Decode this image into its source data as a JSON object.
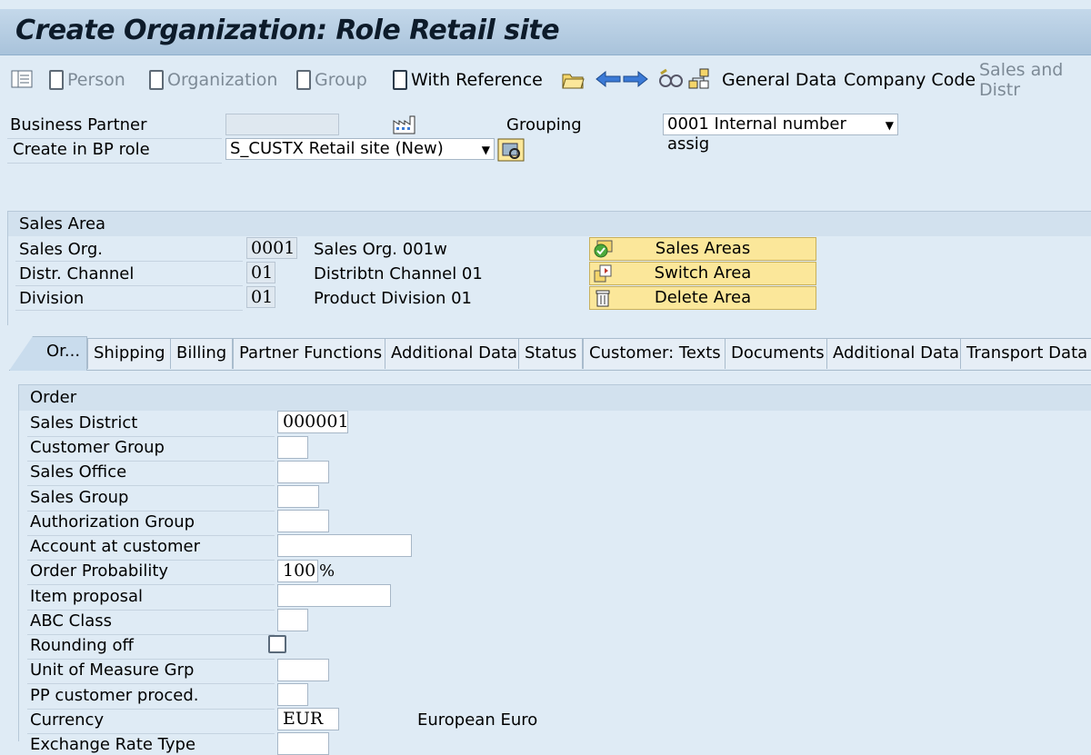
{
  "window": {
    "title": "Create Organization: Role Retail site"
  },
  "toolbar": {
    "person": "Person",
    "organization": "Organization",
    "group": "Group",
    "with_reference": "With Reference",
    "general_data": "General Data",
    "company_code": "Company Code",
    "sales_and_distr": "Sales and Distr"
  },
  "header": {
    "business_partner_label": "Business Partner",
    "business_partner_value": "",
    "grouping_label": "Grouping",
    "grouping_value": "0001 Internal number assig",
    "create_in_role_label": "Create in BP role",
    "create_in_role_value": "S_CUSTX Retail site (New)"
  },
  "sales_area": {
    "title": "Sales Area",
    "sales_org_label": "Sales Org.",
    "sales_org_value": "0001",
    "sales_org_desc": "Sales Org. 001w",
    "distr_channel_label": "Distr. Channel",
    "distr_channel_value": "01",
    "distr_channel_desc": "Distribtn Channel 01",
    "division_label": "Division",
    "division_value": "01",
    "division_desc": "Product Division 01",
    "btn_sales_areas": "Sales Areas",
    "btn_switch_area": "Switch Area",
    "btn_delete_area": "Delete Area"
  },
  "tabs": [
    {
      "label": "Or..."
    },
    {
      "label": "Shipping"
    },
    {
      "label": "Billing"
    },
    {
      "label": "Partner Functions"
    },
    {
      "label": "Additional Data"
    },
    {
      "label": "Status"
    },
    {
      "label": "Customer: Texts"
    },
    {
      "label": "Documents"
    },
    {
      "label": "Additional Data"
    },
    {
      "label": "Transport Data"
    }
  ],
  "order": {
    "title": "Order",
    "fields": [
      {
        "label": "Sales District",
        "value": "000001"
      },
      {
        "label": "Customer Group",
        "value": ""
      },
      {
        "label": "Sales Office",
        "value": ""
      },
      {
        "label": "Sales Group",
        "value": ""
      },
      {
        "label": "Authorization Group",
        "value": ""
      },
      {
        "label": "Account at customer",
        "value": ""
      },
      {
        "label": "Order Probability",
        "value": "100",
        "unit": "%"
      },
      {
        "label": "Item proposal",
        "value": ""
      },
      {
        "label": "ABC Class",
        "value": ""
      },
      {
        "label": "Rounding off",
        "value": ""
      },
      {
        "label": "Unit of Measure Grp",
        "value": ""
      },
      {
        "label": "PP customer proced.",
        "value": ""
      },
      {
        "label": "Currency",
        "value": "EUR",
        "desc": "European Euro"
      },
      {
        "label": "Exchange Rate Type",
        "value": ""
      }
    ]
  },
  "colors": {
    "background": "#dfebf5",
    "title_bar": "#b8cfe3",
    "button_yellow": "#fbe79a"
  }
}
